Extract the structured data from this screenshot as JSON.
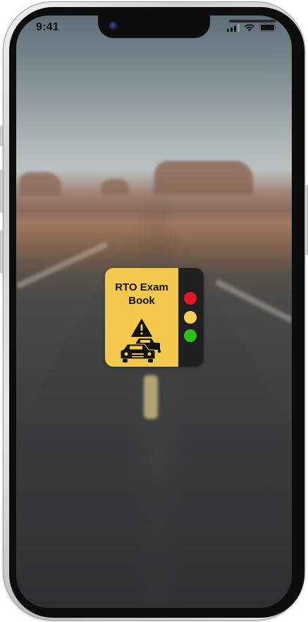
{
  "status_bar": {
    "time": "9:41",
    "icons": [
      "cellular-signal-icon",
      "wifi-icon",
      "battery-icon"
    ]
  },
  "app_icon": {
    "title_line1": "RTO Exam",
    "title_line2": "Book",
    "icons": [
      "warning-triangle-icon",
      "cars-icon"
    ],
    "traffic_light": [
      "red",
      "yellow",
      "green"
    ]
  },
  "colors": {
    "icon_yellow": "#f2c94c",
    "icon_dark": "#202020",
    "light_red": "#e3172b",
    "light_yellow": "#f6d155",
    "light_green": "#2dc21a"
  }
}
